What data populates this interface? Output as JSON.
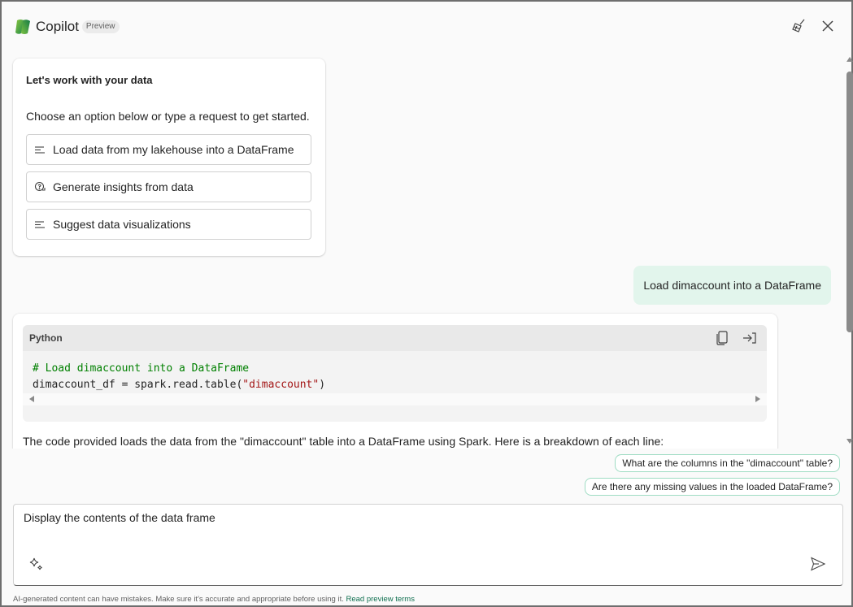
{
  "header": {
    "title": "Copilot",
    "badge": "Preview",
    "icons": [
      "copilot-logo-icon",
      "broom-clear-icon",
      "close-icon"
    ]
  },
  "welcome": {
    "title": "Let's work with your data",
    "subtitle": "Choose an option below or type a request to get started.",
    "options": [
      {
        "label": "Load data from my lakehouse into a DataFrame",
        "icon": "text-lines-icon"
      },
      {
        "label": "Generate insights from data",
        "icon": "chat-question-icon"
      },
      {
        "label": "Suggest data visualizations",
        "icon": "text-lines-icon"
      }
    ]
  },
  "user_message": "Load dimaccount into a DataFrame",
  "response": {
    "code": {
      "language": "Python",
      "comment": "# Load dimaccount into a DataFrame",
      "line2_prefix": "dimaccount_df = spark.read.table(",
      "line2_string": "\"dimaccount\"",
      "line2_suffix": ")",
      "actions": [
        "copy-icon",
        "insert-icon"
      ]
    },
    "text": "The code provided loads the data from the \"dimaccount\" table into a DataFrame using Spark. Here is a breakdown of each line:"
  },
  "suggestions": [
    "What are the columns in the \"dimaccount\" table?",
    "Are there any missing values in the loaded DataFrame?"
  ],
  "input": {
    "value": "Display the contents of the data frame"
  },
  "footer": {
    "disclaimer": "AI-generated content can have mistakes. Make sure it's accurate and appropriate before using it.",
    "link": "Read preview terms"
  },
  "colors": {
    "accent": "#0f6f4f",
    "user_bubble": "#e2f5ec",
    "suggestion_border": "#9fdcc3"
  }
}
